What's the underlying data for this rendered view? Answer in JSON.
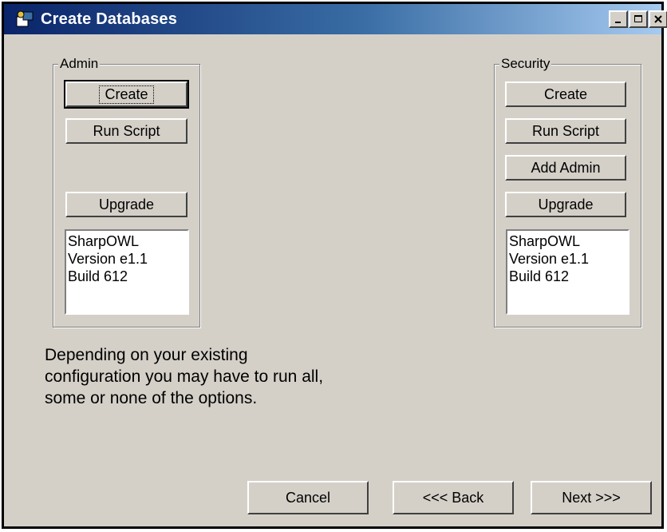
{
  "window": {
    "title": "Create Databases",
    "controls": [
      "minimize",
      "maximize",
      "close"
    ]
  },
  "admin": {
    "legend": "Admin",
    "buttons": {
      "create": "Create",
      "run_script": "Run Script",
      "upgrade": "Upgrade"
    },
    "info": [
      "SharpOWL",
      "Version e1.1",
      "Build 612"
    ]
  },
  "security": {
    "legend": "Security",
    "buttons": {
      "create": "Create",
      "run_script": "Run Script",
      "add_admin": "Add Admin",
      "upgrade": "Upgrade"
    },
    "info": [
      "SharpOWL",
      "Version e1.1",
      "Build 612"
    ]
  },
  "note": "Depending on your existing configuration you may have to run all, some or none of the options.",
  "footer": {
    "cancel": "Cancel",
    "back": "<<< Back",
    "next": "Next >>>"
  },
  "colors": {
    "face": "#d4d0c8",
    "title_start": "#0a246a",
    "title_end": "#a6caf0"
  }
}
